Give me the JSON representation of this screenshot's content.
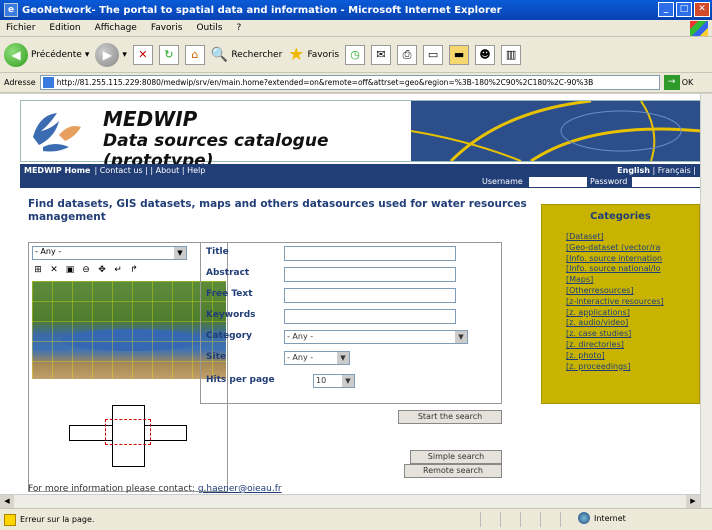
{
  "window": {
    "title": "GeoNetwork- The portal to spatial data and information - Microsoft Internet Explorer"
  },
  "menu": [
    "Fichier",
    "Edition",
    "Affichage",
    "Favoris",
    "Outils",
    "?"
  ],
  "toolbar": {
    "back_label": "Précédente",
    "search_label": "Rechercher",
    "favorites_label": "Favoris"
  },
  "address": {
    "label": "Adresse",
    "url": "http://81.255.115.229:8080/medwip/srv/en/main.home?extended=on&remote=off&attrset=geo&region=%3B-180%2C90%2C180%2C-90%3B",
    "go_label": "OK"
  },
  "banner": {
    "title": "MEDWIP",
    "subtitle": "Data sources catalogue (prototype)"
  },
  "nav": {
    "home": "MEDWIP Home",
    "links": "| Contact us | | About | Help",
    "lang_en": "English",
    "lang_fr": "| Français |"
  },
  "login": {
    "username_label": "Username",
    "password_label": "Password"
  },
  "heading": "Find datasets, GIS datasets, maps and others datasources used for water resources management",
  "map": {
    "region_select": "- Any -"
  },
  "form": {
    "title_label": "Title",
    "abstract_label": "Abstract",
    "freetext_label": "Free Text",
    "keywords_label": "Keywords",
    "category_label": "Category",
    "category_value": "- Any -",
    "site_label": "Site",
    "site_value": "- Any -",
    "hits_label": "Hits per page",
    "hits_value": "10",
    "start_search": "Start the search",
    "simple_search": "Simple search",
    "remote_search": "Remote search"
  },
  "categories": {
    "title": "Categories",
    "items": [
      "[Dataset]",
      "[Geo-dataset (vector/ra",
      "[Info. source internation",
      "[Info. source national/lo",
      "[Maps]",
      "[Otherresources]",
      "[z-interactive resources]",
      "[z. applications]",
      "[z. audio/video]",
      "[z. case studies]",
      "[z. directories]",
      "[z. photo]",
      "[z. proceedings]"
    ]
  },
  "footer": {
    "text": "For more information please contact:",
    "email": "g.haener@oieau.fr"
  },
  "status": {
    "text": "Erreur sur la page.",
    "zone": "Internet"
  }
}
